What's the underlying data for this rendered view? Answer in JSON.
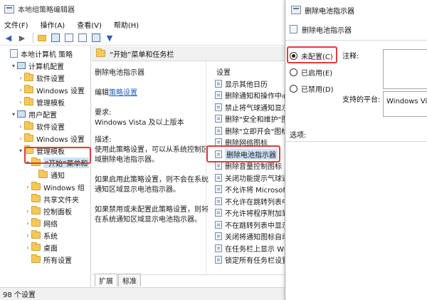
{
  "window": {
    "title": "本地组策略编辑器"
  },
  "menu": [
    "文件(F)",
    "操作(A)",
    "查看(V)",
    "帮助(H)"
  ],
  "tree": [
    {
      "label": "本地计算机 策略",
      "indent": 0,
      "icon": "policy-icon",
      "arrow": ""
    },
    {
      "label": "计算机配置",
      "indent": 1,
      "icon": "computer-icon",
      "arrow": "▾"
    },
    {
      "label": "软件设置",
      "indent": 2,
      "icon": "folder-icon",
      "arrow": "›"
    },
    {
      "label": "Windows 设置",
      "indent": 2,
      "icon": "folder-icon",
      "arrow": "›"
    },
    {
      "label": "管理模板",
      "indent": 2,
      "icon": "folder-icon",
      "arrow": "›"
    },
    {
      "label": "用户配置",
      "indent": 1,
      "icon": "computer-icon",
      "arrow": "▾"
    },
    {
      "label": "软件设置",
      "indent": 2,
      "icon": "folder-icon",
      "arrow": "›"
    },
    {
      "label": "Windows 设置",
      "indent": 2,
      "icon": "folder-icon",
      "arrow": "›"
    },
    {
      "label": "管理模板",
      "indent": 2,
      "icon": "folder-icon",
      "arrow": "▾"
    },
    {
      "label": "“开始”菜单和",
      "indent": 3,
      "icon": "folder-icon",
      "arrow": "▾",
      "selected": true
    },
    {
      "label": "通知",
      "indent": 4,
      "icon": "folder-icon",
      "arrow": ""
    },
    {
      "label": "Windows 组",
      "indent": 3,
      "icon": "folder-icon",
      "arrow": "›"
    },
    {
      "label": "共享文件夹",
      "indent": 3,
      "icon": "folder-icon",
      "arrow": ""
    },
    {
      "label": "控制面板",
      "indent": 3,
      "icon": "folder-icon",
      "arrow": "›"
    },
    {
      "label": "网络",
      "indent": 3,
      "icon": "folder-icon",
      "arrow": "›"
    },
    {
      "label": "系统",
      "indent": 3,
      "icon": "folder-icon",
      "arrow": "›"
    },
    {
      "label": "桌面",
      "indent": 3,
      "icon": "folder-icon",
      "arrow": "›"
    },
    {
      "label": "所有设置",
      "indent": 3,
      "icon": "folder-icon",
      "arrow": ""
    }
  ],
  "header": {
    "title": "“开始”菜单和任务栏"
  },
  "description": {
    "title": "删除电池指示器",
    "edit_prefix": "编辑",
    "edit_link": "策略设置",
    "requirement_label": "要求:",
    "requirement_value": "Windows Vista 及以上版本",
    "desc_label": "描述:",
    "lines": [
      "使用此策略设置，可以从系统控制区",
      "域删除电池指示器。",
      "",
      "如果启用此策略设置，则不会在系统",
      "通知区域显示电池指示器。",
      "",
      "如果禁用或未配置此策略设置，则将",
      "在系统通知区域显示电池指示器。"
    ]
  },
  "list": {
    "column_header": "设置",
    "items": [
      "显示其他日历",
      "删除通知和操作中心",
      "禁止将气球通知显示",
      "删除\"安全和维护\"图",
      "删除\"立即开会\"图标",
      "删除网络图标",
      "删除电池指示器",
      "删除音量控制图标",
      "关闭功能提示气球通",
      "不允许将 Microsoft",
      "不允许在跳转列表中",
      "不允许将程序附加到",
      "不在跳转列表中显示",
      "关闭将通知图标自动",
      "在任务栏上显示 Win",
      "锁定所有任务栏设置"
    ],
    "selected_index": 6
  },
  "tabs": [
    "扩展",
    "标准"
  ],
  "status": "98 个设置",
  "dialog": {
    "title": "删除电池指示器",
    "subtitle": "删除电池指示器",
    "options": [
      "未配置(C)",
      "已启用(E)",
      "已禁用(D)"
    ],
    "selected_option": 0,
    "comment_label": "注释:",
    "platform_label": "支持的平台:",
    "platform_value": "Windows Vista 及以上版本",
    "options_label": "选项:"
  },
  "colors": {
    "highlight_border": "#e23b3b",
    "selection": "#cce4f7",
    "link": "#1f5fbf"
  }
}
